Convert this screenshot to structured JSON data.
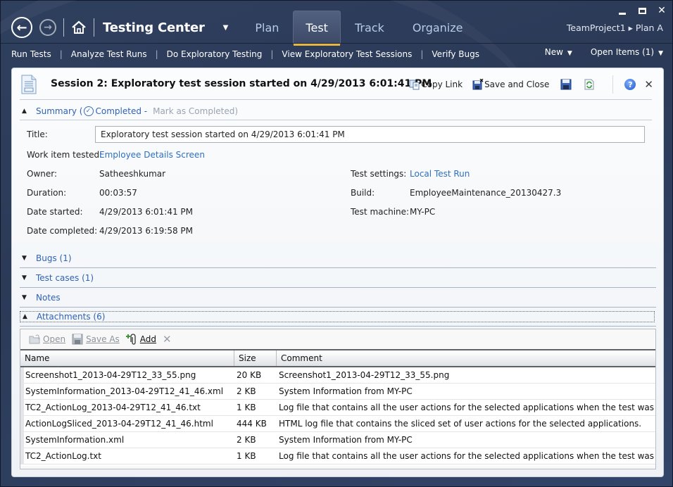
{
  "window": {
    "controls": {
      "minimize": "minimize",
      "maximize": "maximize",
      "close": "✕"
    }
  },
  "header": {
    "app_title": "Testing Center",
    "back_icon": "←",
    "forward_icon": "→",
    "caret": "▼",
    "tabs": [
      {
        "label": "Plan",
        "active": false
      },
      {
        "label": "Test",
        "active": true
      },
      {
        "label": "Track",
        "active": false
      },
      {
        "label": "Organize",
        "active": false
      }
    ],
    "project_breadcrumb": "TeamProject1 ▸ Plan A",
    "accent_color": "#e6b73f"
  },
  "subnav": {
    "items": [
      "Run Tests",
      "Analyze Test Runs",
      "Do Exploratory Testing",
      "View Exploratory Test Sessions",
      "Verify Bugs"
    ],
    "separator": "|",
    "new_label": "New",
    "open_items_label": "Open Items (1)",
    "caret": "▼"
  },
  "session": {
    "title": "Session 2: Exploratory test session started on 4/29/2013 6:01:41 PM",
    "toolbar": {
      "copy_link": "Copy Link",
      "save_and_close": "Save and Close",
      "help": "?",
      "close": "✕"
    },
    "summary": {
      "label": "Summary (",
      "status": "Completed -",
      "mark_completed": "Mark as Completed)",
      "chevron": "▲"
    },
    "fields": {
      "title_label": "Title:",
      "title_value": "Exploratory test session started on 4/29/2013 6:01:41 PM",
      "work_item_label": "Work item tested:",
      "work_item_value": "Employee Details Screen",
      "owner_label": "Owner:",
      "owner_value": "Satheeshkumar",
      "duration_label": "Duration:",
      "duration_value": "00:03:57",
      "date_started_label": "Date started:",
      "date_started_value": "4/29/2013 6:01:41 PM",
      "date_completed_label": "Date completed:",
      "date_completed_value": "4/29/2013 6:19:58 PM",
      "test_settings_label": "Test settings:",
      "test_settings_value": "Local Test Run",
      "build_label": "Build:",
      "build_value": "EmployeeMaintenance_20130427.3",
      "test_machine_label": "Test machine:",
      "test_machine_value": "MY-PC"
    },
    "sections": {
      "bugs": "Bugs (1)",
      "test_cases": "Test cases (1)",
      "notes": "Notes",
      "attachments": "Attachments (6)",
      "collapsed_chevron": "▼",
      "expanded_chevron": "▲"
    },
    "attachments": {
      "toolbar": {
        "open": "Open",
        "save_as": "Save As",
        "add": "Add",
        "delete": "✕"
      },
      "columns": [
        "Name",
        "Size",
        "Comment"
      ],
      "rows": [
        {
          "name": "Screenshot1_2013-04-29T12_33_55.png",
          "size": "20 KB",
          "comment": "Screenshot1_2013-04-29T12_33_55.png"
        },
        {
          "name": "SystemInformation_2013-04-29T12_41_46.xml",
          "size": "2 KB",
          "comment": "System Information from MY-PC"
        },
        {
          "name": "TC2_ActionLog_2013-04-29T12_41_46.txt",
          "size": "1 KB",
          "comment": "Log file that contains all the user actions for the selected applications when the test was run."
        },
        {
          "name": "ActionLogSliced_2013-04-29T12_41_46.html",
          "size": "444 KB",
          "comment": "HTML log file that contains the sliced set of user actions for the selected applications."
        },
        {
          "name": "SystemInformation.xml",
          "size": "2 KB",
          "comment": "System Information from MY-PC"
        },
        {
          "name": "TC2_ActionLog.txt",
          "size": "1 KB",
          "comment": "Log file that contains all the user actions for the selected applications when the test was run."
        }
      ]
    }
  }
}
